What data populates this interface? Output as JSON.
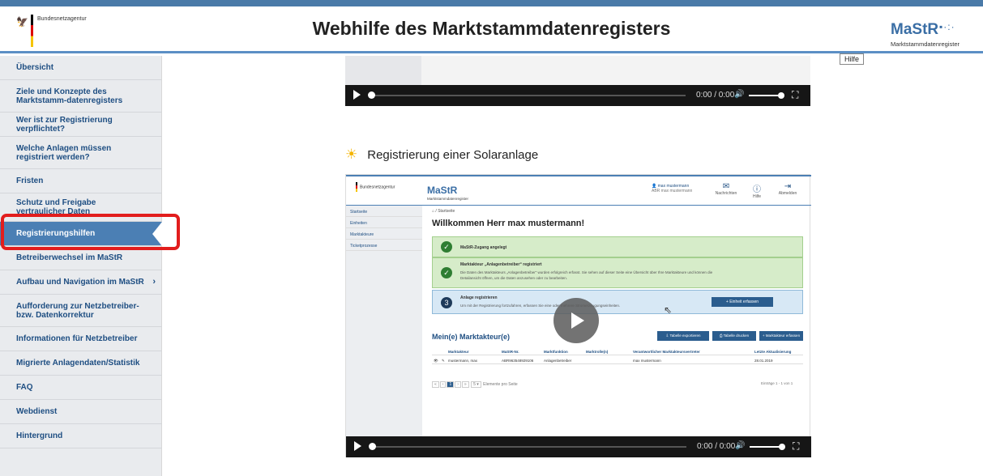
{
  "header": {
    "agency": "Bundesnetzagentur",
    "title": "Webhilfe des Marktstammdatenregisters",
    "logo_name": "MaStR",
    "logo_sub": "Marktstammdatenregister",
    "tooltip": "Hilfe"
  },
  "sidebar": {
    "items": [
      {
        "label": "Übersicht"
      },
      {
        "label": "Ziele und Konzepte des Marktstamm-datenregisters"
      },
      {
        "label": "Wer ist zur Registrierung verpflichtet?"
      },
      {
        "label": "Welche Anlagen müssen registriert werden?"
      },
      {
        "label": "Fristen"
      },
      {
        "label": "Schutz und Freigabe vertraulicher Daten"
      },
      {
        "label": "Registrierungshilfen"
      },
      {
        "label": "Betreiberwechsel im MaStR"
      },
      {
        "label": "Aufbau und Navigation im MaStR"
      },
      {
        "label": "Aufforderung zur Netzbetreiber- bzw. Datenkorrektur"
      },
      {
        "label": "Informationen für Netzbetreiber"
      },
      {
        "label": "Migrierte Anlagendaten/Statistik"
      },
      {
        "label": "FAQ"
      },
      {
        "label": "Webdienst"
      },
      {
        "label": "Hintergrund"
      }
    ],
    "chevron": "›"
  },
  "video": {
    "time": "0:00 / 0:00"
  },
  "section": {
    "title": "Registrierung einer Solaranlage"
  },
  "app": {
    "agency": "Bundesnetzagentur",
    "logo_name": "MaStR",
    "logo_sub": "Marktstammdatenregister",
    "user_name": "max mustermann",
    "user_sub": "ABR max mustermann",
    "nav_messages": "Nachrichten",
    "nav_help": "Hilfe",
    "nav_logout": "Abmelden",
    "side": [
      "Startseite",
      "Einheiten",
      "Marktakteure",
      "Ticketprozesse"
    ],
    "crumb": "Startseite",
    "welcome": "Willkommen Herr max mustermann!",
    "box1_title": "MaStR-Zugang angelegt",
    "box2_title": "Marktakteur „Anlagenbetreiber“ registriert",
    "box2_text": "Die Daten des Marktakteurs „Anlagenbetreiber“ wurden erfolgreich erfasst. Sie sehen auf dieser Seite eine Übersicht über Ihre Marktakteure und können die Detailansicht öffnen, um die Daten anzusehen oder zu bearbeiten.",
    "box3_num": "3",
    "box3_title": "Anlage registrieren",
    "box3_text": "Um mit der Registrierung fortzufahren, erfassen Sie eine oder mehrere Stromerzeugungseinheiten.",
    "box3_button": "+ Einheit erfassen",
    "table_title": "Mein(e) Marktakteur(e)",
    "btn_export": "Tabelle exportieren",
    "btn_print": "Tabelle drucken",
    "btn_add": "+ Marktakteur erfassen",
    "columns": [
      "Marktakteur",
      "MaStR-Nr.",
      "Marktfunktion",
      "Marktrolle(n)",
      "Verantwortlicher Marktakteursvertreter",
      "Letzte Aktualisierung"
    ],
    "row": [
      "mustermann, max",
      "ABR963548929106",
      "Anlagenbetreiber",
      "",
      "max mustermann",
      "28.01.2019"
    ],
    "page_current": "1",
    "per_page": "Elemente pro Seite",
    "count": "Einträge 1 - 1 von 1"
  }
}
